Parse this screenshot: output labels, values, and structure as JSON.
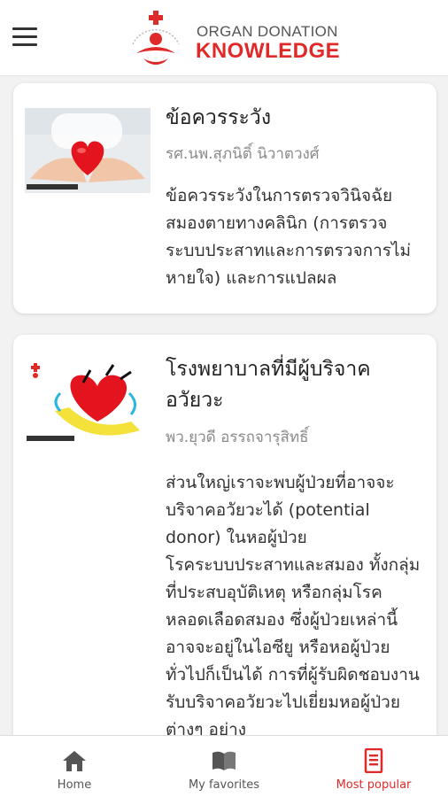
{
  "header": {
    "menu_icon": "hamburger-menu-icon",
    "logo_line1": "ORGAN DONATION",
    "logo_line2": "KNOWLEDGE",
    "brand_color": "#e02a2a"
  },
  "articles": [
    {
      "title": "ข้อควรระวัง",
      "author": "รศ.นพ.สุภนิติ์ นิวาตวงศ์",
      "description": "ข้อควรระวังในการตรวจวินิจฉัยสมองตายทางคลินิก (การตรวจระบบประสาทและการตรวจการไม่หายใจ) และการแปลผล",
      "thumbnail": "hands-holding-heart-image"
    },
    {
      "title": "โรงพยาบาลที่มีผู้บริจาคอวัยวะ",
      "author": "พว.ยุวดี อรรถจารุสิทธิ์",
      "description": "ส่วนใหญ่เราจะพบผู้ป่วยที่อาจจะบริจาคอวัยวะได้ (potential donor) ในหอผู้ป่วยโรคระบบประสาทและสมอง ทั้งกลุ่มที่ประสบอุบัติเหตุ หรือกลุ่มโรคหลอดเลือดสมอง ซึ่งผู้ป่วยเหล่านี้อาจจะอยู่ในไอซียู หรือหอผู้ป่วยทั่วไปก็เป็นได้ การที่ผู้รับผิดชอบงานรับบริจาคอวัยวะไปเยี่ยมหอผู้ป่วยต่างๆ อย่าง",
      "thumbnail": "heart-in-hand-illustration"
    }
  ],
  "nav": [
    {
      "label": "Home",
      "icon": "home-icon",
      "active": false
    },
    {
      "label": "My favorites",
      "icon": "book-icon",
      "active": false
    },
    {
      "label": "Most popular",
      "icon": "document-icon",
      "active": true
    }
  ]
}
